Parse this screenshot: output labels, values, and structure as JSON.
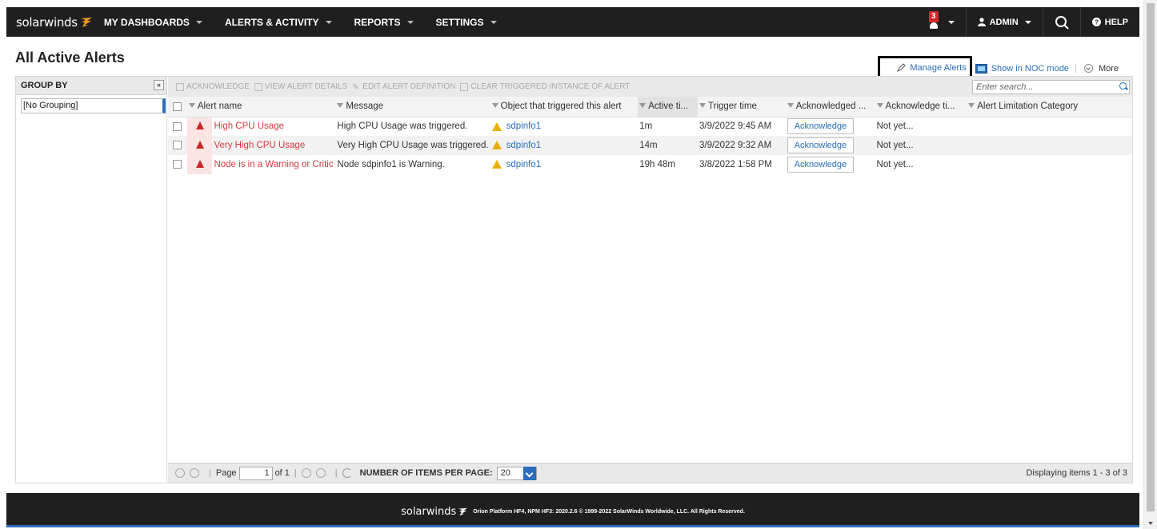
{
  "brand": {
    "logo_text": "solarwinds"
  },
  "nav": {
    "items": [
      {
        "label": "MY DASHBOARDS"
      },
      {
        "label": "ALERTS & ACTIVITY"
      },
      {
        "label": "REPORTS"
      },
      {
        "label": "SETTINGS"
      }
    ],
    "notification_count": "3",
    "user_label": "ADMIN",
    "help_label": "HELP"
  },
  "page": {
    "title": "All Active Alerts",
    "manage_alerts_label": "Manage Alerts",
    "noc_label": "Show in NOC mode",
    "more_label": "More"
  },
  "groupby": {
    "title": "GROUP BY",
    "collapse_label": "«",
    "selected": "[No Grouping]"
  },
  "toolbar": {
    "acknowledge": "ACKNOWLEDGE",
    "view_details": "VIEW ALERT DETAILS",
    "edit_definition": "EDIT ALERT DEFINITION",
    "clear_instance": "CLEAR TRIGGERED INSTANCE OF ALERT",
    "search_placeholder": "Enter search..."
  },
  "table": {
    "columns": [
      "Alert name",
      "Message",
      "Object that triggered this alert",
      "Active ti...",
      "Trigger time",
      "Acknowledged ...",
      "Acknowledge ti...",
      "Alert Limitation Category"
    ],
    "rows": [
      {
        "alert_name": "High CPU Usage",
        "message": "High CPU Usage was triggered.",
        "object": "sdpinfo1",
        "active_time": "1m",
        "trigger_time": "3/9/2022 9:45 AM",
        "ack_button": "Acknowledge",
        "ack_time": "Not yet..."
      },
      {
        "alert_name": "Very High CPU Usage",
        "message": "Very High CPU Usage was triggered.",
        "object": "sdpinfo1",
        "active_time": "14m",
        "trigger_time": "3/9/2022 9:32 AM",
        "ack_button": "Acknowledge",
        "ack_time": "Not yet..."
      },
      {
        "alert_name": "Node is in a Warning or Critic",
        "message": "Node sdpinfo1 is Warning.",
        "object": "sdpinfo1",
        "active_time": "19h 48m",
        "trigger_time": "3/8/2022 1:58 PM",
        "ack_button": "Acknowledge",
        "ack_time": "Not yet..."
      }
    ]
  },
  "pager": {
    "page_label": "Page",
    "page_value": "1",
    "of_label": "of 1",
    "items_per_page_label": "NUMBER OF ITEMS PER PAGE:",
    "items_per_page_value": "20",
    "displaying": "Displaying items 1 - 3 of 3"
  },
  "footer": {
    "logo_text": "solarwinds",
    "text": "Orion Platform HF4, NPM HF3: 2020.2.6 © 1999-2022 SolarWinds Worldwide, LLC. All Rights Reserved."
  },
  "colors": {
    "accent": "#2a6ebb",
    "brand_orange": "#f89c1c",
    "critical": "#c62828",
    "warning": "#e8b100",
    "topbar": "#1f1f1f"
  }
}
